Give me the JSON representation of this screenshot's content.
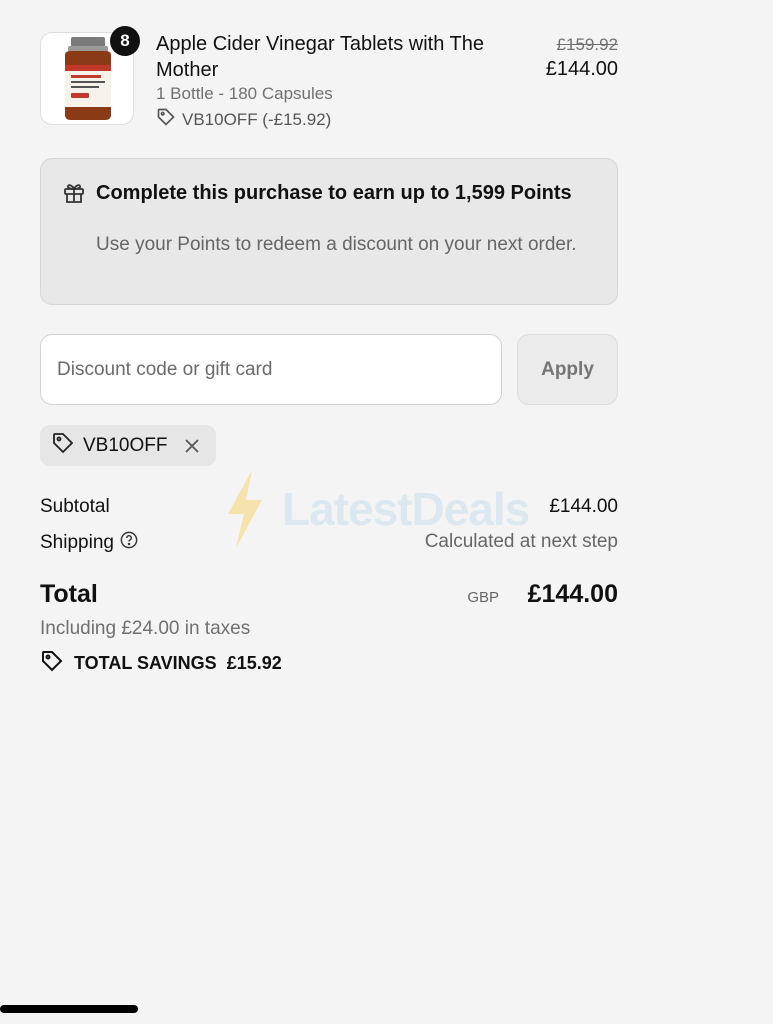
{
  "product": {
    "quantity": "8",
    "name": "Apple Cider Vinegar Tablets with The Mother",
    "variant": "1 Bottle - 180 Capsules",
    "discount": "VB10OFF (-£15.92)",
    "original_price": "£159.92",
    "price": "£144.00"
  },
  "points": {
    "title": "Complete this purchase to earn up to 1,599 Points",
    "subtitle": "Use your Points to redeem a discount on your next order."
  },
  "discount_form": {
    "placeholder": "Discount code or gift card",
    "apply_label": "Apply"
  },
  "applied_code": "VB10OFF",
  "summary": {
    "subtotal_label": "Subtotal",
    "subtotal_value": "£144.00",
    "shipping_label": "Shipping",
    "shipping_value": "Calculated at next step",
    "total_label": "Total",
    "currency": "GBP",
    "total_value": "£144.00",
    "tax_note": "Including £24.00 in taxes",
    "savings_label": "TOTAL SAVINGS",
    "savings_value": "£15.92"
  },
  "watermark": "LatestDeals",
  "colors": {
    "background": "#f4f4f4",
    "points_box": "#e8e8e8",
    "text": "#111111",
    "muted": "#707070"
  }
}
